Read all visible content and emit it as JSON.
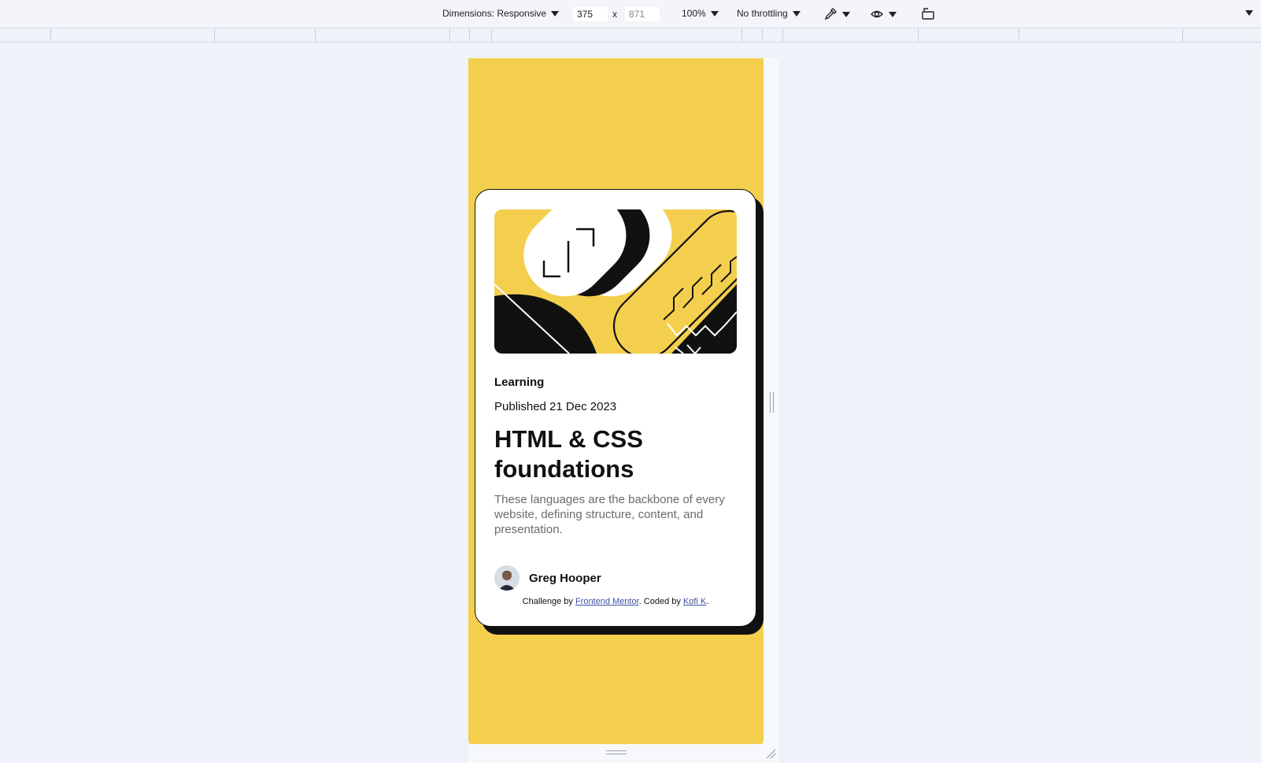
{
  "devtools": {
    "dimensions_label": "Dimensions: Responsive",
    "width": "375",
    "height": "871",
    "separator": "x",
    "zoom": "100%",
    "throttling": "No throttling"
  },
  "card": {
    "category": "Learning",
    "published": "Published 21 Dec 2023",
    "title": "HTML & CSS foundations",
    "description": "These languages are the backbone of every website, defining structure, content, and presentation.",
    "author": "Greg Hooper"
  },
  "attribution": {
    "prefix": "Challenge by",
    "link1": "Frontend Mentor",
    "middle": ". Coded by",
    "link2": "Kofi K",
    "suffix": "."
  },
  "colors": {
    "page_background": "#f4cf4e",
    "card": "#ffffff",
    "text": "#111111",
    "muted_text": "#6b6b6b",
    "link": "#3e52a3"
  }
}
